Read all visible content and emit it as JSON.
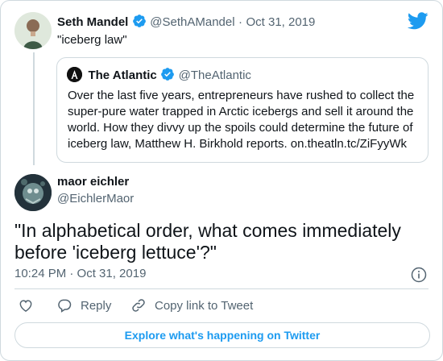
{
  "colors": {
    "accent": "#1d9bf0",
    "text": "#0f1419",
    "muted": "#536471",
    "border": "#cfd9de"
  },
  "tweet": {
    "author_name": "Seth Mandel",
    "author_handle": "@SethAMandel",
    "separator": "·",
    "date": "Oct 31, 2019",
    "text": "\"iceberg law\"",
    "quoted": {
      "author_name": "The Atlantic",
      "author_handle": "@TheAtlantic",
      "text": "Over the last five years, entrepreneurs have rushed to collect the super-pure water trapped in Arctic icebergs and sell it around the world. How they divvy up the spoils could determine the future of iceberg law, Matthew H. Birkhold reports. on.theatln.tc/ZiFyyWk"
    }
  },
  "reply": {
    "author_name": "maor eichler",
    "author_handle": "@EichlerMaor",
    "text": "\"In alphabetical order, what comes immediately before 'iceberg lettuce'?\"",
    "timestamp": "10:24 PM · Oct 31, 2019"
  },
  "actions": {
    "reply_label": "Reply",
    "copy_label": "Copy link to Tweet"
  },
  "footer": {
    "explore_label": "Explore what's happening on Twitter"
  },
  "icons": [
    "twitter-logo-icon",
    "verified-badge-icon",
    "atlantic-logo-icon",
    "info-icon",
    "heart-icon",
    "reply-icon",
    "link-icon"
  ]
}
